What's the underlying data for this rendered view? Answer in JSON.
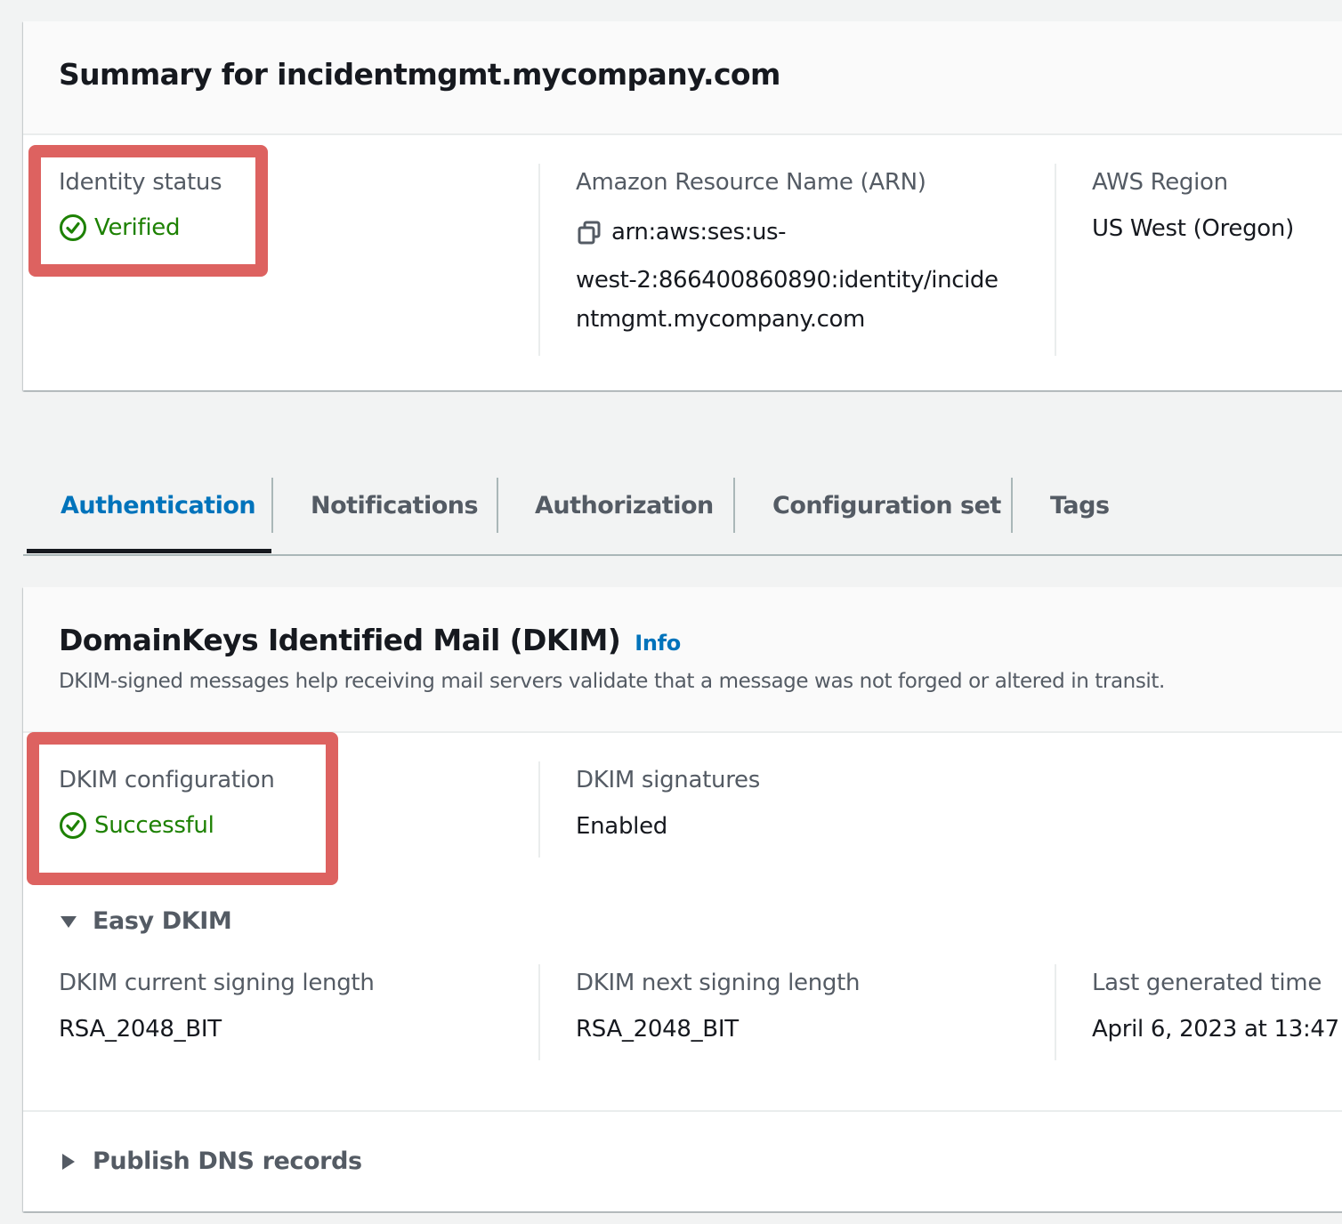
{
  "summary": {
    "title": "Summary for incidentmgmt.mycompany.com",
    "identity_status": {
      "label": "Identity status",
      "value": "Verified",
      "icon": "check-circle-icon"
    },
    "arn": {
      "label": "Amazon Resource Name (ARN)",
      "line1": "arn:aws:ses:us-",
      "line2": "west-2:866400860890:identity/incide",
      "line3": "ntmgmt.mycompany.com",
      "icon": "copy-icon"
    },
    "region": {
      "label": "AWS Region",
      "value": "US West (Oregon)"
    }
  },
  "tabs": [
    {
      "label": "Authentication",
      "active": true
    },
    {
      "label": "Notifications",
      "active": false
    },
    {
      "label": "Authorization",
      "active": false
    },
    {
      "label": "Configuration set",
      "active": false
    },
    {
      "label": "Tags",
      "active": false
    }
  ],
  "dkim": {
    "title": "DomainKeys Identified Mail (DKIM)",
    "info_label": "Info",
    "description": "DKIM-signed messages help receiving mail servers validate that a message was not forged or altered in transit.",
    "configuration": {
      "label": "DKIM configuration",
      "value": "Successful",
      "icon": "check-circle-icon"
    },
    "signatures": {
      "label": "DKIM signatures",
      "value": "Enabled"
    },
    "easy_dkim": {
      "label": "Easy DKIM",
      "expanded": true,
      "current_signing_length": {
        "label": "DKIM current signing length",
        "value": "RSA_2048_BIT"
      },
      "next_signing_length": {
        "label": "DKIM next signing length",
        "value": "RSA_2048_BIT"
      },
      "last_generated": {
        "label": "Last generated time",
        "value": "April 6, 2023 at 13:47"
      }
    },
    "publish_dns": {
      "label": "Publish DNS records",
      "expanded": false
    }
  },
  "colors": {
    "success": "#1d8102",
    "link": "#0073bb",
    "highlight": "#dd6260"
  }
}
